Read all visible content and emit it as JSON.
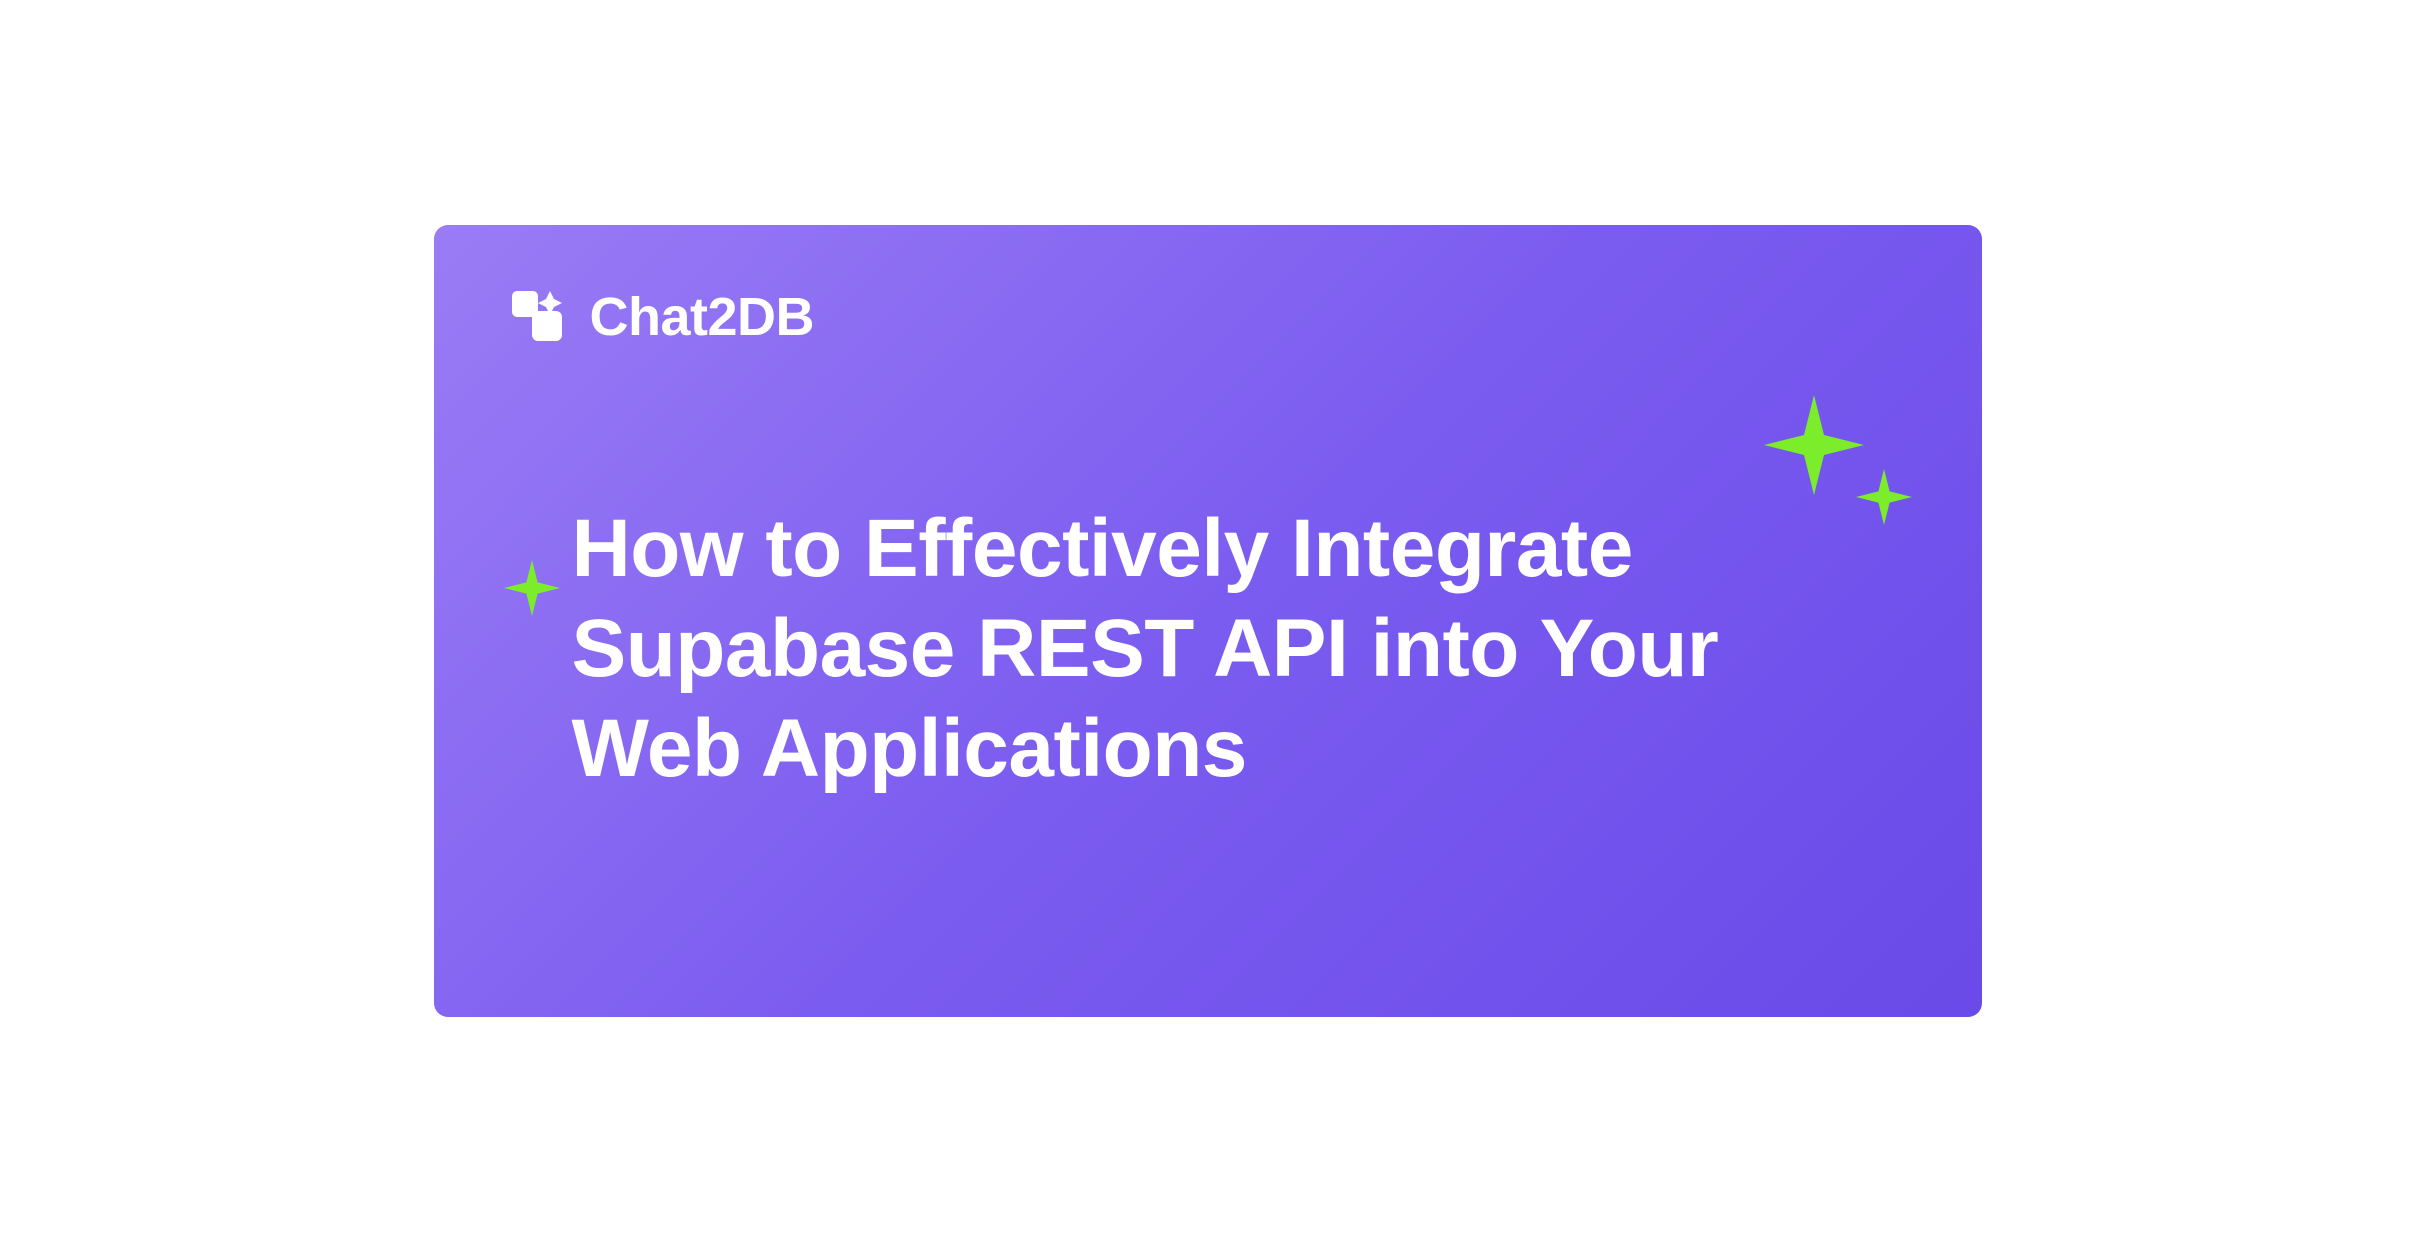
{
  "brand": {
    "name": "Chat2DB"
  },
  "headline": "How to Effectively Integrate Supabase REST API into Your Web Applications",
  "colors": {
    "accent_sparkle": "#7ced2b",
    "text": "#ffffff",
    "bg_gradient_start": "#9a7cf5",
    "bg_gradient_end": "#6a4ae8"
  }
}
